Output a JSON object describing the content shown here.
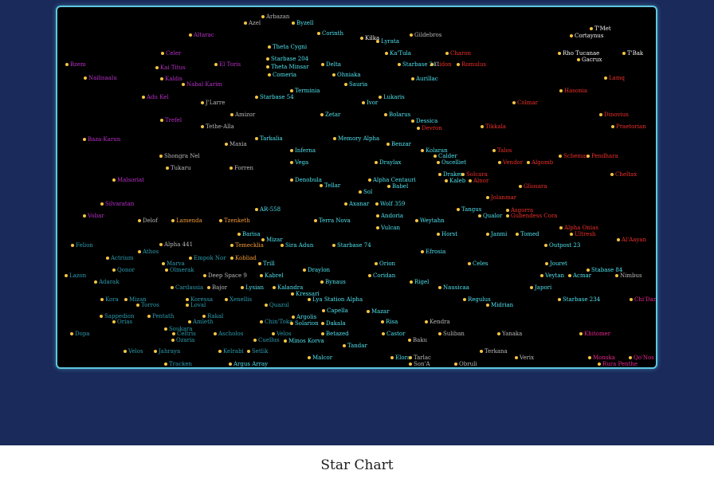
{
  "title": "Star Chart",
  "colors": {
    "background": "#1a2a5a",
    "map": "#000000",
    "border": "#5ec8e0",
    "dot": "#f5c542"
  },
  "groups": {
    "cyan": "#4fe3ef",
    "gray": "#b9b9b9",
    "purple": "#b830c8",
    "red": "#f0302a",
    "orange": "#f39a38",
    "teal": "#2c9db0",
    "white": "#f2f2f2",
    "pink": "#e8268f"
  },
  "stars": [
    {
      "name": "Arbazan",
      "g": "gray"
    },
    {
      "name": "Azel",
      "g": "gray"
    },
    {
      "name": "Byzell",
      "g": "cyan"
    },
    {
      "name": "Altarac",
      "g": "purple"
    },
    {
      "name": "Corinth",
      "g": "cyan"
    },
    {
      "name": "Kilka",
      "g": "white"
    },
    {
      "name": "Lyrata",
      "g": "cyan"
    },
    {
      "name": "Gildebros",
      "g": "gray"
    },
    {
      "name": "T'Met",
      "g": "white"
    },
    {
      "name": "Cortaynus",
      "g": "white"
    },
    {
      "name": "Theta Cygni",
      "g": "cyan"
    },
    {
      "name": "Celer",
      "g": "purple"
    },
    {
      "name": "Ka'Tula",
      "g": "cyan"
    },
    {
      "name": "Charon",
      "g": "red"
    },
    {
      "name": "Rho Tucanae",
      "g": "white"
    },
    {
      "name": "T'Bak",
      "g": "white"
    },
    {
      "name": "Starbase 204",
      "g": "cyan"
    },
    {
      "name": "Gacrux",
      "g": "white"
    },
    {
      "name": "Bzem",
      "g": "purple"
    },
    {
      "name": "Kai Titus",
      "g": "purple"
    },
    {
      "name": "El Toris",
      "g": "purple"
    },
    {
      "name": "Theta Minsar",
      "g": "cyan"
    },
    {
      "name": "Delta",
      "g": "cyan"
    },
    {
      "name": "Starbase 241",
      "g": "cyan"
    },
    {
      "name": "Cidon",
      "g": "red"
    },
    {
      "name": "Romulus",
      "g": "red"
    },
    {
      "name": "Comeria",
      "g": "cyan"
    },
    {
      "name": "Ohniaka",
      "g": "cyan"
    },
    {
      "name": "Nailisaalu",
      "g": "purple"
    },
    {
      "name": "Kaldis",
      "g": "purple"
    },
    {
      "name": "Aurillac",
      "g": "cyan"
    },
    {
      "name": "Lamq",
      "g": "red"
    },
    {
      "name": "Nabal Karim",
      "g": "purple"
    },
    {
      "name": "Sauria",
      "g": "cyan"
    },
    {
      "name": "Terminia",
      "g": "cyan"
    },
    {
      "name": "Hasonia",
      "g": "red"
    },
    {
      "name": "Adu Kel",
      "g": "purple"
    },
    {
      "name": "Starbase 54",
      "g": "cyan"
    },
    {
      "name": "Lukaris",
      "g": "cyan"
    },
    {
      "name": "J'Larre",
      "g": "gray"
    },
    {
      "name": "Ivor",
      "g": "cyan"
    },
    {
      "name": "Colmar",
      "g": "red"
    },
    {
      "name": "Amizor",
      "g": "gray"
    },
    {
      "name": "Zetar",
      "g": "cyan"
    },
    {
      "name": "Bolarus",
      "g": "cyan"
    },
    {
      "name": "Dinovius",
      "g": "red"
    },
    {
      "name": "Trefel",
      "g": "purple"
    },
    {
      "name": "Dessica",
      "g": "cyan"
    },
    {
      "name": "Tethe-Alla",
      "g": "gray"
    },
    {
      "name": "Tikkala",
      "g": "red"
    },
    {
      "name": "Devron",
      "g": "red"
    },
    {
      "name": "Praetorian",
      "g": "red"
    },
    {
      "name": "Tarkalia",
      "g": "cyan"
    },
    {
      "name": "Memory Alpha",
      "g": "cyan"
    },
    {
      "name": "Baza-Karun",
      "g": "purple"
    },
    {
      "name": "Maxia",
      "g": "gray"
    },
    {
      "name": "Benzar",
      "g": "cyan"
    },
    {
      "name": "Inferna",
      "g": "cyan"
    },
    {
      "name": "Kolaran",
      "g": "cyan"
    },
    {
      "name": "Talos",
      "g": "red"
    },
    {
      "name": "Shongra Nel",
      "g": "gray"
    },
    {
      "name": "Calder",
      "g": "cyan"
    },
    {
      "name": "Schemar",
      "g": "red"
    },
    {
      "name": "Pendhara",
      "g": "red"
    },
    {
      "name": "Vega",
      "g": "cyan"
    },
    {
      "name": "Draylax",
      "g": "cyan"
    },
    {
      "name": "Oscelliet",
      "g": "cyan"
    },
    {
      "name": "Vendor",
      "g": "red"
    },
    {
      "name": "Algomb",
      "g": "red"
    },
    {
      "name": "Tukaru",
      "g": "gray"
    },
    {
      "name": "Forren",
      "g": "gray"
    },
    {
      "name": "Draken",
      "g": "cyan"
    },
    {
      "name": "Solcara",
      "g": "red"
    },
    {
      "name": "Cheltax",
      "g": "red"
    },
    {
      "name": "Malsoriat",
      "g": "purple"
    },
    {
      "name": "Denobula",
      "g": "cyan"
    },
    {
      "name": "Alpha Centauri",
      "g": "cyan"
    },
    {
      "name": "Kaleb",
      "g": "cyan"
    },
    {
      "name": "Alnor",
      "g": "red"
    },
    {
      "name": "Tellar",
      "g": "cyan"
    },
    {
      "name": "Babel",
      "g": "cyan"
    },
    {
      "name": "Gliosara",
      "g": "red"
    },
    {
      "name": "Sol",
      "g": "cyan"
    },
    {
      "name": "Jolanmar",
      "g": "red"
    },
    {
      "name": "Silvaratan",
      "g": "purple"
    },
    {
      "name": "Axanar",
      "g": "cyan"
    },
    {
      "name": "Wolf 359",
      "g": "cyan"
    },
    {
      "name": "AR-558",
      "g": "cyan"
    },
    {
      "name": "Tangus",
      "g": "cyan"
    },
    {
      "name": "Asgorra",
      "g": "red"
    },
    {
      "name": "Vobar",
      "g": "purple"
    },
    {
      "name": "Andoria",
      "g": "cyan"
    },
    {
      "name": "Qualor",
      "g": "cyan"
    },
    {
      "name": "Gubendess Cora",
      "g": "red"
    },
    {
      "name": "Delof",
      "g": "gray"
    },
    {
      "name": "Lamenda",
      "g": "orange"
    },
    {
      "name": "Tzenketh",
      "g": "orange"
    },
    {
      "name": "Terra Nova",
      "g": "cyan"
    },
    {
      "name": "Weytahn",
      "g": "cyan"
    },
    {
      "name": "Vulcan",
      "g": "cyan"
    },
    {
      "name": "Alpha Onias",
      "g": "red"
    },
    {
      "name": "Ultresh",
      "g": "red"
    },
    {
      "name": "Barisa",
      "g": "cyan"
    },
    {
      "name": "Horst",
      "g": "cyan"
    },
    {
      "name": "Janmi",
      "g": "cyan"
    },
    {
      "name": "Tomed",
      "g": "cyan"
    },
    {
      "name": "Al'Aayan",
      "g": "red"
    },
    {
      "name": "Mizar",
      "g": "cyan"
    },
    {
      "name": "Felion",
      "g": "teal"
    },
    {
      "name": "Alpha 441",
      "g": "gray"
    },
    {
      "name": "Temecklia",
      "g": "orange"
    },
    {
      "name": "Sira Adun",
      "g": "cyan"
    },
    {
      "name": "Starbase 74",
      "g": "cyan"
    },
    {
      "name": "Outpost 23",
      "g": "cyan"
    },
    {
      "name": "Athos",
      "g": "teal"
    },
    {
      "name": "Efrosia",
      "g": "cyan"
    },
    {
      "name": "Actrium",
      "g": "teal"
    },
    {
      "name": "Empok Nor",
      "g": "teal"
    },
    {
      "name": "Kobliad",
      "g": "orange"
    },
    {
      "name": "Marva",
      "g": "teal"
    },
    {
      "name": "Trill",
      "g": "cyan"
    },
    {
      "name": "Orion",
      "g": "cyan"
    },
    {
      "name": "Celes",
      "g": "cyan"
    },
    {
      "name": "Jouret",
      "g": "cyan"
    },
    {
      "name": "Qonor",
      "g": "teal"
    },
    {
      "name": "Olmerak",
      "g": "teal"
    },
    {
      "name": "Draylon",
      "g": "cyan"
    },
    {
      "name": "Stabase 84",
      "g": "cyan"
    },
    {
      "name": "Lazon",
      "g": "teal"
    },
    {
      "name": "Deep Space 9",
      "g": "gray"
    },
    {
      "name": "Kabrel",
      "g": "cyan"
    },
    {
      "name": "Coridan",
      "g": "cyan"
    },
    {
      "name": "Veytan",
      "g": "cyan"
    },
    {
      "name": "Acmar",
      "g": "cyan"
    },
    {
      "name": "Nimbus",
      "g": "gray"
    },
    {
      "name": "Adarak",
      "g": "teal"
    },
    {
      "name": "Bynaus",
      "g": "cyan"
    },
    {
      "name": "Rigel",
      "g": "cyan"
    },
    {
      "name": "Cardassia",
      "g": "teal"
    },
    {
      "name": "Bajor",
      "g": "gray"
    },
    {
      "name": "Lysian",
      "g": "cyan"
    },
    {
      "name": "Kalandra",
      "g": "cyan"
    },
    {
      "name": "Nausicaa",
      "g": "cyan"
    },
    {
      "name": "Japori",
      "g": "cyan"
    },
    {
      "name": "Kressari",
      "g": "cyan"
    },
    {
      "name": "Kora",
      "g": "teal"
    },
    {
      "name": "Mizan",
      "g": "teal"
    },
    {
      "name": "Koressa",
      "g": "teal"
    },
    {
      "name": "Xenellis",
      "g": "teal"
    },
    {
      "name": "Lya Station Alpha",
      "g": "cyan"
    },
    {
      "name": "Regulus",
      "g": "cyan"
    },
    {
      "name": "Starbase 234",
      "g": "cyan"
    },
    {
      "name": "Chi'Dan",
      "g": "pink"
    },
    {
      "name": "Torros",
      "g": "teal"
    },
    {
      "name": "Loval",
      "g": "teal"
    },
    {
      "name": "Quazul",
      "g": "teal"
    },
    {
      "name": "Midrian",
      "g": "cyan"
    },
    {
      "name": "Capella",
      "g": "cyan"
    },
    {
      "name": "Sappedion",
      "g": "teal"
    },
    {
      "name": "Pentath",
      "g": "teal"
    },
    {
      "name": "Rakal",
      "g": "teal"
    },
    {
      "name": "Argolis",
      "g": "cyan"
    },
    {
      "name": "Mazar",
      "g": "cyan"
    },
    {
      "name": "Orias",
      "g": "teal"
    },
    {
      "name": "Amleth",
      "g": "teal"
    },
    {
      "name": "Chin'Toka",
      "g": "teal"
    },
    {
      "name": "Solarion",
      "g": "cyan"
    },
    {
      "name": "Dakala",
      "g": "cyan"
    },
    {
      "name": "Risa",
      "g": "cyan"
    },
    {
      "name": "Kendra",
      "g": "gray"
    },
    {
      "name": "Soukara",
      "g": "teal"
    },
    {
      "name": "Dopa",
      "g": "teal"
    },
    {
      "name": "Celtris",
      "g": "teal"
    },
    {
      "name": "Ascholos",
      "g": "teal"
    },
    {
      "name": "Velos",
      "g": "teal"
    },
    {
      "name": "Betazed",
      "g": "cyan"
    },
    {
      "name": "Castor",
      "g": "cyan"
    },
    {
      "name": "Suliban",
      "g": "gray"
    },
    {
      "name": "Yanaka",
      "g": "gray"
    },
    {
      "name": "Khitomer",
      "g": "pink"
    },
    {
      "name": "Ozaria",
      "g": "teal"
    },
    {
      "name": "Cuellus",
      "g": "teal"
    },
    {
      "name": "Minos Korva",
      "g": "cyan"
    },
    {
      "name": "Baku",
      "g": "gray"
    },
    {
      "name": "Tandar",
      "g": "cyan"
    },
    {
      "name": "Velos",
      "g": "teal"
    },
    {
      "name": "Jahraya",
      "g": "teal"
    },
    {
      "name": "Kelrabi",
      "g": "teal"
    },
    {
      "name": "Setlik",
      "g": "teal"
    },
    {
      "name": "Malcor",
      "g": "cyan"
    },
    {
      "name": "Elora",
      "g": "cyan"
    },
    {
      "name": "Tarlac",
      "g": "gray"
    },
    {
      "name": "Terkana",
      "g": "gray"
    },
    {
      "name": "Verix",
      "g": "gray"
    },
    {
      "name": "Monska",
      "g": "pink"
    },
    {
      "name": "Qo'Nos",
      "g": "pink"
    },
    {
      "name": "Tracken",
      "g": "teal"
    },
    {
      "name": "Argus Array",
      "g": "cyan"
    },
    {
      "name": "Son'A",
      "g": "gray"
    },
    {
      "name": "Obruli",
      "g": "gray"
    },
    {
      "name": "Rura Penthe",
      "g": "pink"
    }
  ]
}
